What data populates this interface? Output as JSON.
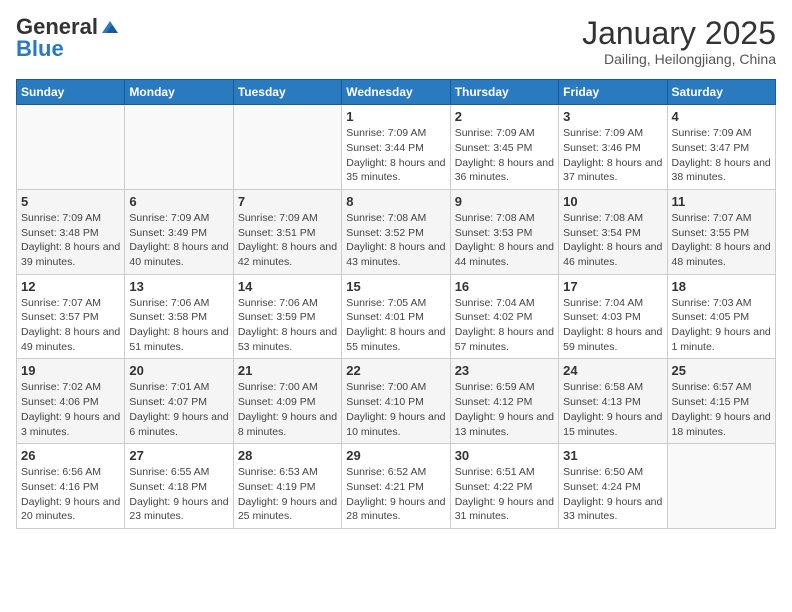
{
  "logo": {
    "general": "General",
    "blue": "Blue"
  },
  "header": {
    "month": "January 2025",
    "location": "Dailing, Heilongjiang, China"
  },
  "weekdays": [
    "Sunday",
    "Monday",
    "Tuesday",
    "Wednesday",
    "Thursday",
    "Friday",
    "Saturday"
  ],
  "weeks": [
    [
      {
        "day": "",
        "sunrise": "",
        "sunset": "",
        "daylight": ""
      },
      {
        "day": "",
        "sunrise": "",
        "sunset": "",
        "daylight": ""
      },
      {
        "day": "",
        "sunrise": "",
        "sunset": "",
        "daylight": ""
      },
      {
        "day": "1",
        "sunrise": "Sunrise: 7:09 AM",
        "sunset": "Sunset: 3:44 PM",
        "daylight": "Daylight: 8 hours and 35 minutes."
      },
      {
        "day": "2",
        "sunrise": "Sunrise: 7:09 AM",
        "sunset": "Sunset: 3:45 PM",
        "daylight": "Daylight: 8 hours and 36 minutes."
      },
      {
        "day": "3",
        "sunrise": "Sunrise: 7:09 AM",
        "sunset": "Sunset: 3:46 PM",
        "daylight": "Daylight: 8 hours and 37 minutes."
      },
      {
        "day": "4",
        "sunrise": "Sunrise: 7:09 AM",
        "sunset": "Sunset: 3:47 PM",
        "daylight": "Daylight: 8 hours and 38 minutes."
      }
    ],
    [
      {
        "day": "5",
        "sunrise": "Sunrise: 7:09 AM",
        "sunset": "Sunset: 3:48 PM",
        "daylight": "Daylight: 8 hours and 39 minutes."
      },
      {
        "day": "6",
        "sunrise": "Sunrise: 7:09 AM",
        "sunset": "Sunset: 3:49 PM",
        "daylight": "Daylight: 8 hours and 40 minutes."
      },
      {
        "day": "7",
        "sunrise": "Sunrise: 7:09 AM",
        "sunset": "Sunset: 3:51 PM",
        "daylight": "Daylight: 8 hours and 42 minutes."
      },
      {
        "day": "8",
        "sunrise": "Sunrise: 7:08 AM",
        "sunset": "Sunset: 3:52 PM",
        "daylight": "Daylight: 8 hours and 43 minutes."
      },
      {
        "day": "9",
        "sunrise": "Sunrise: 7:08 AM",
        "sunset": "Sunset: 3:53 PM",
        "daylight": "Daylight: 8 hours and 44 minutes."
      },
      {
        "day": "10",
        "sunrise": "Sunrise: 7:08 AM",
        "sunset": "Sunset: 3:54 PM",
        "daylight": "Daylight: 8 hours and 46 minutes."
      },
      {
        "day": "11",
        "sunrise": "Sunrise: 7:07 AM",
        "sunset": "Sunset: 3:55 PM",
        "daylight": "Daylight: 8 hours and 48 minutes."
      }
    ],
    [
      {
        "day": "12",
        "sunrise": "Sunrise: 7:07 AM",
        "sunset": "Sunset: 3:57 PM",
        "daylight": "Daylight: 8 hours and 49 minutes."
      },
      {
        "day": "13",
        "sunrise": "Sunrise: 7:06 AM",
        "sunset": "Sunset: 3:58 PM",
        "daylight": "Daylight: 8 hours and 51 minutes."
      },
      {
        "day": "14",
        "sunrise": "Sunrise: 7:06 AM",
        "sunset": "Sunset: 3:59 PM",
        "daylight": "Daylight: 8 hours and 53 minutes."
      },
      {
        "day": "15",
        "sunrise": "Sunrise: 7:05 AM",
        "sunset": "Sunset: 4:01 PM",
        "daylight": "Daylight: 8 hours and 55 minutes."
      },
      {
        "day": "16",
        "sunrise": "Sunrise: 7:04 AM",
        "sunset": "Sunset: 4:02 PM",
        "daylight": "Daylight: 8 hours and 57 minutes."
      },
      {
        "day": "17",
        "sunrise": "Sunrise: 7:04 AM",
        "sunset": "Sunset: 4:03 PM",
        "daylight": "Daylight: 8 hours and 59 minutes."
      },
      {
        "day": "18",
        "sunrise": "Sunrise: 7:03 AM",
        "sunset": "Sunset: 4:05 PM",
        "daylight": "Daylight: 9 hours and 1 minute."
      }
    ],
    [
      {
        "day": "19",
        "sunrise": "Sunrise: 7:02 AM",
        "sunset": "Sunset: 4:06 PM",
        "daylight": "Daylight: 9 hours and 3 minutes."
      },
      {
        "day": "20",
        "sunrise": "Sunrise: 7:01 AM",
        "sunset": "Sunset: 4:07 PM",
        "daylight": "Daylight: 9 hours and 6 minutes."
      },
      {
        "day": "21",
        "sunrise": "Sunrise: 7:00 AM",
        "sunset": "Sunset: 4:09 PM",
        "daylight": "Daylight: 9 hours and 8 minutes."
      },
      {
        "day": "22",
        "sunrise": "Sunrise: 7:00 AM",
        "sunset": "Sunset: 4:10 PM",
        "daylight": "Daylight: 9 hours and 10 minutes."
      },
      {
        "day": "23",
        "sunrise": "Sunrise: 6:59 AM",
        "sunset": "Sunset: 4:12 PM",
        "daylight": "Daylight: 9 hours and 13 minutes."
      },
      {
        "day": "24",
        "sunrise": "Sunrise: 6:58 AM",
        "sunset": "Sunset: 4:13 PM",
        "daylight": "Daylight: 9 hours and 15 minutes."
      },
      {
        "day": "25",
        "sunrise": "Sunrise: 6:57 AM",
        "sunset": "Sunset: 4:15 PM",
        "daylight": "Daylight: 9 hours and 18 minutes."
      }
    ],
    [
      {
        "day": "26",
        "sunrise": "Sunrise: 6:56 AM",
        "sunset": "Sunset: 4:16 PM",
        "daylight": "Daylight: 9 hours and 20 minutes."
      },
      {
        "day": "27",
        "sunrise": "Sunrise: 6:55 AM",
        "sunset": "Sunset: 4:18 PM",
        "daylight": "Daylight: 9 hours and 23 minutes."
      },
      {
        "day": "28",
        "sunrise": "Sunrise: 6:53 AM",
        "sunset": "Sunset: 4:19 PM",
        "daylight": "Daylight: 9 hours and 25 minutes."
      },
      {
        "day": "29",
        "sunrise": "Sunrise: 6:52 AM",
        "sunset": "Sunset: 4:21 PM",
        "daylight": "Daylight: 9 hours and 28 minutes."
      },
      {
        "day": "30",
        "sunrise": "Sunrise: 6:51 AM",
        "sunset": "Sunset: 4:22 PM",
        "daylight": "Daylight: 9 hours and 31 minutes."
      },
      {
        "day": "31",
        "sunrise": "Sunrise: 6:50 AM",
        "sunset": "Sunset: 4:24 PM",
        "daylight": "Daylight: 9 hours and 33 minutes."
      },
      {
        "day": "",
        "sunrise": "",
        "sunset": "",
        "daylight": ""
      }
    ]
  ]
}
